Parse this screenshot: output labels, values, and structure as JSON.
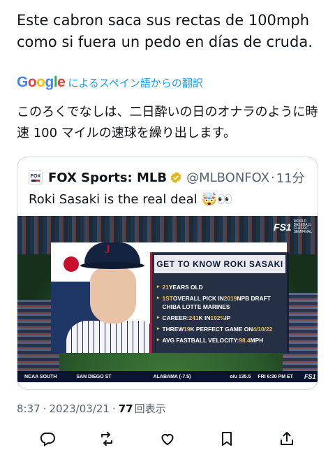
{
  "tweet": {
    "text": "Este cabron saca sus rectas de 100mph como si fuera un pedo en días de cruda.",
    "translate_label": "によるスペイン語からの翻訳",
    "google_logo": "Google",
    "translated_text": "このろくでなしは、二日酔いの日のオナラのように時速 100 マイルの速球を繰り出します。"
  },
  "quote": {
    "name": "FOX Sports: MLB",
    "handle": "@MLBONFOX",
    "separator": "·",
    "time": "11分",
    "text": "Roki Sasaki is the real deal",
    "emoji": "🤯👀",
    "media": {
      "card_title": "GET TO KNOW ROKI SASAKI",
      "lines": [
        {
          "pre": "",
          "hl": "21",
          "post": " YEARS OLD"
        },
        {
          "pre": "",
          "hl": "1ST",
          "post": " OVERALL PICK IN ",
          "hl2": "2019",
          "post2": " NPB DRAFT"
        },
        {
          "pre": "CHIBA LOTTE MARINES",
          "hl": "",
          "post": ""
        },
        {
          "pre": "CAREER: ",
          "hl": "241",
          "post": " K IN ",
          "hl2": "192⅔",
          "post2": " IP"
        },
        {
          "pre": "THREW ",
          "hl": "19",
          "post": " K PERFECT GAME ON ",
          "hl2": "4/10/22",
          "post2": ""
        },
        {
          "pre": "AVG FASTBALL VELOCITY: ",
          "hl": "98.4",
          "post": " MPH"
        }
      ],
      "cap_letter": "J",
      "network": "FS1",
      "wbc": [
        "WORLD",
        "BASEBALL",
        "CLASSIC",
        "SEMIFINAL"
      ],
      "ticker": [
        "NCAA SOUTH",
        "SAN DIEGO ST",
        "ALABAMA (-7.5)",
        "o/u 135.5",
        "FRI 6:30 PM ET",
        "FS1"
      ]
    }
  },
  "meta": {
    "time": "8:37",
    "sep1": "·",
    "date": "2023/03/21",
    "sep2": "·",
    "views": "77",
    "views_label": "回表示"
  },
  "colors": {
    "accent": "#1d9bf0",
    "text": "#0f1419",
    "muted": "#536471",
    "border": "#cfd9de"
  },
  "icons": [
    "reply-icon",
    "retweet-icon",
    "like-icon",
    "bookmark-icon",
    "share-icon"
  ]
}
